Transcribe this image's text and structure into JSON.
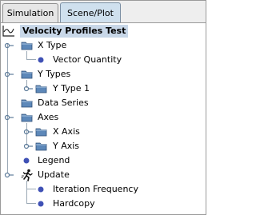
{
  "tabs": [
    {
      "label": "Simulation",
      "active": false
    },
    {
      "label": "Scene/Plot",
      "active": true
    }
  ],
  "tree": {
    "root": "Velocity Profiles Test",
    "x_type": "X Type",
    "vector_quantity": "Vector Quantity",
    "y_types": "Y Types",
    "y_type_1": "Y Type 1",
    "data_series": "Data Series",
    "axes": "Axes",
    "x_axis": "X Axis",
    "y_axis": "Y Axis",
    "legend": "Legend",
    "update": "Update",
    "iteration_frequency": "Iteration Frequency",
    "hardcopy": "Hardcopy"
  },
  "colors": {
    "folder": "#5d88b9",
    "bullet": "#3f51b5",
    "selection": "#c8d7e8"
  }
}
